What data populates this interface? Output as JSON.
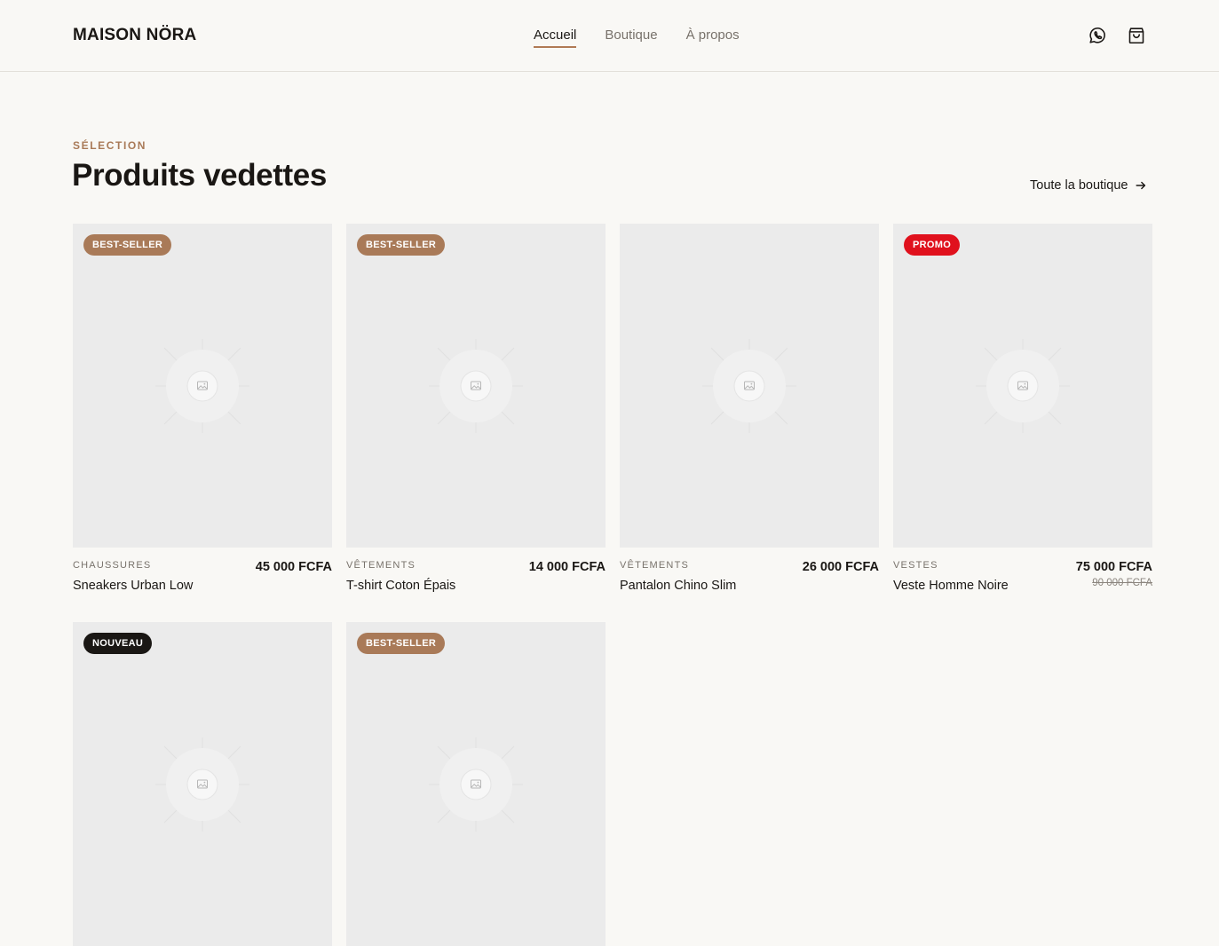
{
  "header": {
    "brand": "MAISON NÖRA",
    "nav": [
      {
        "label": "Accueil",
        "active": true
      },
      {
        "label": "Boutique",
        "active": false
      },
      {
        "label": "À propos",
        "active": false
      }
    ],
    "icons": [
      "whatsapp-icon",
      "shopping-bag-icon"
    ]
  },
  "section": {
    "eyebrow": "SÉLECTION",
    "title": "Produits vedettes",
    "see_all": "Toute la boutique"
  },
  "colors": {
    "background": "#f9f8f5",
    "accent": "#a97a58",
    "promo": "#e0111d",
    "new": "#1a1714",
    "placeholder": "#ebebeb"
  },
  "products": [
    {
      "badge": "BEST-SELLER",
      "badge_type": "best",
      "category": "CHAUSSURES",
      "name": "Sneakers Urban Low",
      "price": "45 000 FCFA",
      "old_price": ""
    },
    {
      "badge": "BEST-SELLER",
      "badge_type": "best",
      "category": "VÊTEMENTS",
      "name": "T-shirt Coton Épais",
      "price": "14 000 FCFA",
      "old_price": ""
    },
    {
      "badge": "",
      "badge_type": "",
      "category": "VÊTEMENTS",
      "name": "Pantalon Chino Slim",
      "price": "26 000 FCFA",
      "old_price": ""
    },
    {
      "badge": "PROMO",
      "badge_type": "promo",
      "category": "VESTES",
      "name": "Veste Homme Noire",
      "price": "75 000 FCFA",
      "old_price": "90 000 FCFA"
    },
    {
      "badge": "NOUVEAU",
      "badge_type": "new",
      "category": "",
      "name": "",
      "price": "",
      "old_price": ""
    },
    {
      "badge": "BEST-SELLER",
      "badge_type": "best",
      "category": "",
      "name": "",
      "price": "",
      "old_price": ""
    }
  ]
}
